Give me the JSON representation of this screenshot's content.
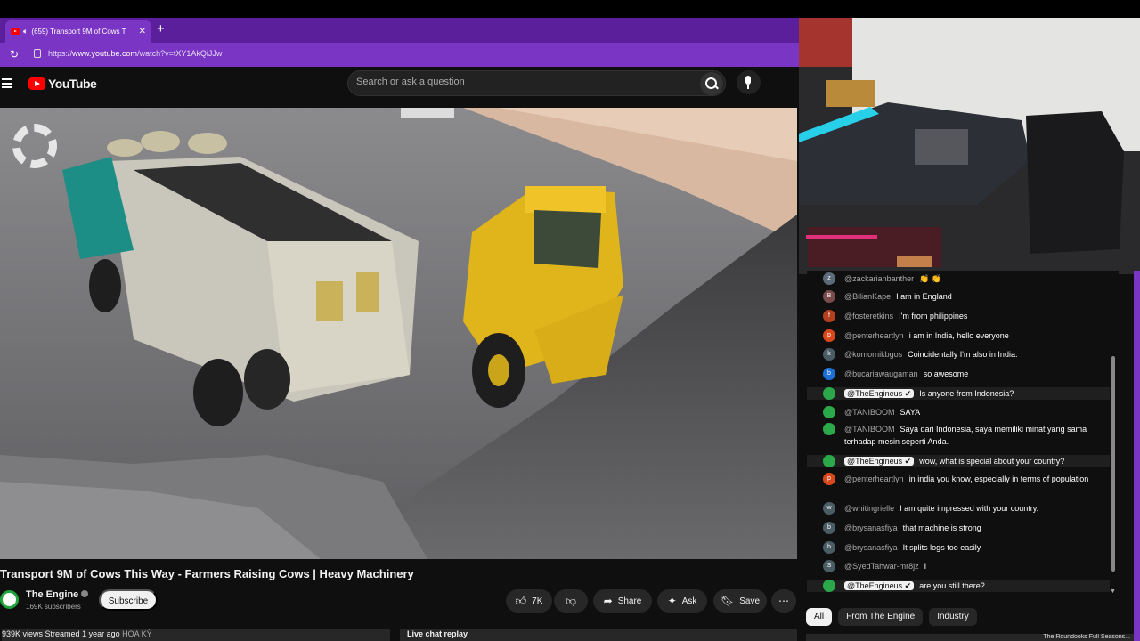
{
  "browser": {
    "tab_title": "(659) Transport 9M of Cows T",
    "new_tab": "+",
    "url_prefix": "https://",
    "url_host": "www.youtube.com",
    "url_path": "/watch?v=tXY1AkQiJJw"
  },
  "youtube": {
    "logo_text": "YouTube",
    "search_placeholder": "Search or ask a question"
  },
  "video": {
    "title": "Transport 9M of Cows This Way - Farmers Raising Cows | Heavy Machinery",
    "channel_name": "The Engine",
    "subscribers": "169K subscribers",
    "subscribe_label": "Subscribe",
    "likes": "7K",
    "share_label": "Share",
    "ask_label": "Ask",
    "save_label": "Save",
    "views": "939K views",
    "streamed": "Streamed 1 year ago",
    "location": "HOA KỲ",
    "live_chat_replay": "Live chat replay"
  },
  "chat": {
    "messages": [
      {
        "initial": "z",
        "color": "#5c6b7a",
        "name": "@zackarianbanther",
        "text": "👏 👏",
        "owner": false
      },
      {
        "initial": "B",
        "color": "#7a4b4b",
        "name": "@BilianKape",
        "text": "I am in England",
        "owner": false
      },
      {
        "initial": "f",
        "color": "#b3401f",
        "name": "@fosteretkins",
        "text": "I'm from philippines",
        "owner": false
      },
      {
        "initial": "p",
        "color": "#d9481c",
        "name": "@penterheartlyn",
        "text": "i am in India, hello everyone",
        "owner": false
      },
      {
        "initial": "k",
        "color": "#4a5c64",
        "name": "@komornikbgos",
        "text": "Coincidentally I'm also in India.",
        "owner": false
      },
      {
        "initial": "b",
        "color": "#1d6fd6",
        "name": "@bucariawaugaman",
        "text": "so awesome",
        "owner": false
      },
      {
        "initial": "",
        "color": "#2aa84a",
        "name": "@TheEngineus ✔",
        "text": "Is anyone from Indonesia?",
        "owner": true
      },
      {
        "initial": "",
        "color": "#2aa84a",
        "name": "@TANIBOOM",
        "text": "SAYA",
        "owner": false
      },
      {
        "initial": "",
        "color": "#2aa84a",
        "name": "@TANIBOOM",
        "text": "Saya dari Indonesia, saya memiliki minat yang sama terhadap mesin seperti Anda.",
        "owner": false
      },
      {
        "initial": "",
        "color": "#2aa84a",
        "name": "@TheEngineus ✔",
        "text": "wow, what is special about your country?",
        "owner": true
      },
      {
        "initial": "p",
        "color": "#d9481c",
        "name": "@penterheartlyn",
        "text": "in india you know, especially in terms of population",
        "owner": false
      },
      {
        "initial": "w",
        "color": "#4a5c64",
        "name": "@whitingrielle",
        "text": "I am quite impressed with your country.",
        "owner": false
      },
      {
        "initial": "b",
        "color": "#4a5c64",
        "name": "@brysanasfiya",
        "text": "that machine is strong",
        "owner": false
      },
      {
        "initial": "b",
        "color": "#4a5c64",
        "name": "@brysanasfiya",
        "text": "It splits logs too easily",
        "owner": false
      },
      {
        "initial": "S",
        "color": "#4a5c64",
        "name": "@SyedTahwar-mr8jz",
        "text": "I",
        "owner": false
      },
      {
        "initial": "",
        "color": "#2aa84a",
        "name": "@TheEngineus ✔",
        "text": "are you still there?",
        "owner": true
      }
    ],
    "chips": [
      "All",
      "From The Engine",
      "Industry"
    ],
    "bottom_text": "The Roundooks Full Seasons..."
  }
}
